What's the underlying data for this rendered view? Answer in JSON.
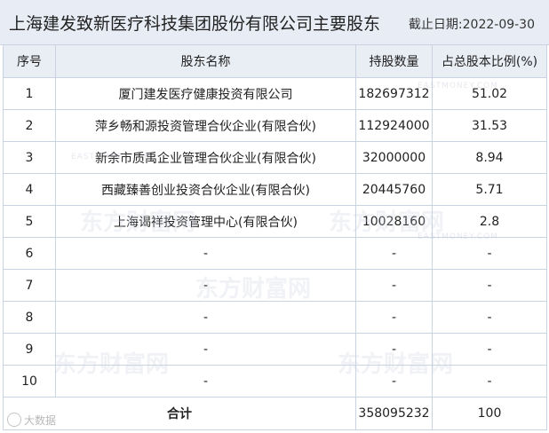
{
  "header": {
    "title": "上海建发致新医疗科技集团股份有限公司主要股东",
    "date": "截止日期:2022-09-30"
  },
  "columns": [
    "序号",
    "股东名称",
    "持股数量",
    "占总股本比例(%)"
  ],
  "rows": [
    {
      "no": "1",
      "name": "厦门建发医疗健康投资有限公司",
      "shares": "182697312",
      "ratio": "51.02"
    },
    {
      "no": "2",
      "name": "萍乡畅和源投资管理合伙企业(有限合伙)",
      "shares": "112924000",
      "ratio": "31.53"
    },
    {
      "no": "3",
      "name": "新余市质禹企业管理合伙企业(有限合伙)",
      "shares": "32000000",
      "ratio": "8.94"
    },
    {
      "no": "4",
      "name": "西藏臻善创业投资合伙企业(有限合伙)",
      "shares": "20445760",
      "ratio": "5.71"
    },
    {
      "no": "5",
      "name": "上海谒祥投资管理中心(有限合伙)",
      "shares": "10028160",
      "ratio": "2.8"
    },
    {
      "no": "6",
      "name": "-",
      "shares": "-",
      "ratio": "-"
    },
    {
      "no": "7",
      "name": "-",
      "shares": "-",
      "ratio": "-"
    },
    {
      "no": "8",
      "name": "-",
      "shares": "-",
      "ratio": "-"
    },
    {
      "no": "9",
      "name": "-",
      "shares": "-",
      "ratio": "-"
    },
    {
      "no": "10",
      "name": "-",
      "shares": "-",
      "ratio": "-"
    }
  ],
  "total": {
    "label": "合计",
    "shares": "358095232",
    "ratio": "100"
  },
  "watermark": {
    "brand": "东方财富网",
    "sub": "EASTMONEY.COM"
  },
  "footer": {
    "logo_text": "大数据"
  }
}
